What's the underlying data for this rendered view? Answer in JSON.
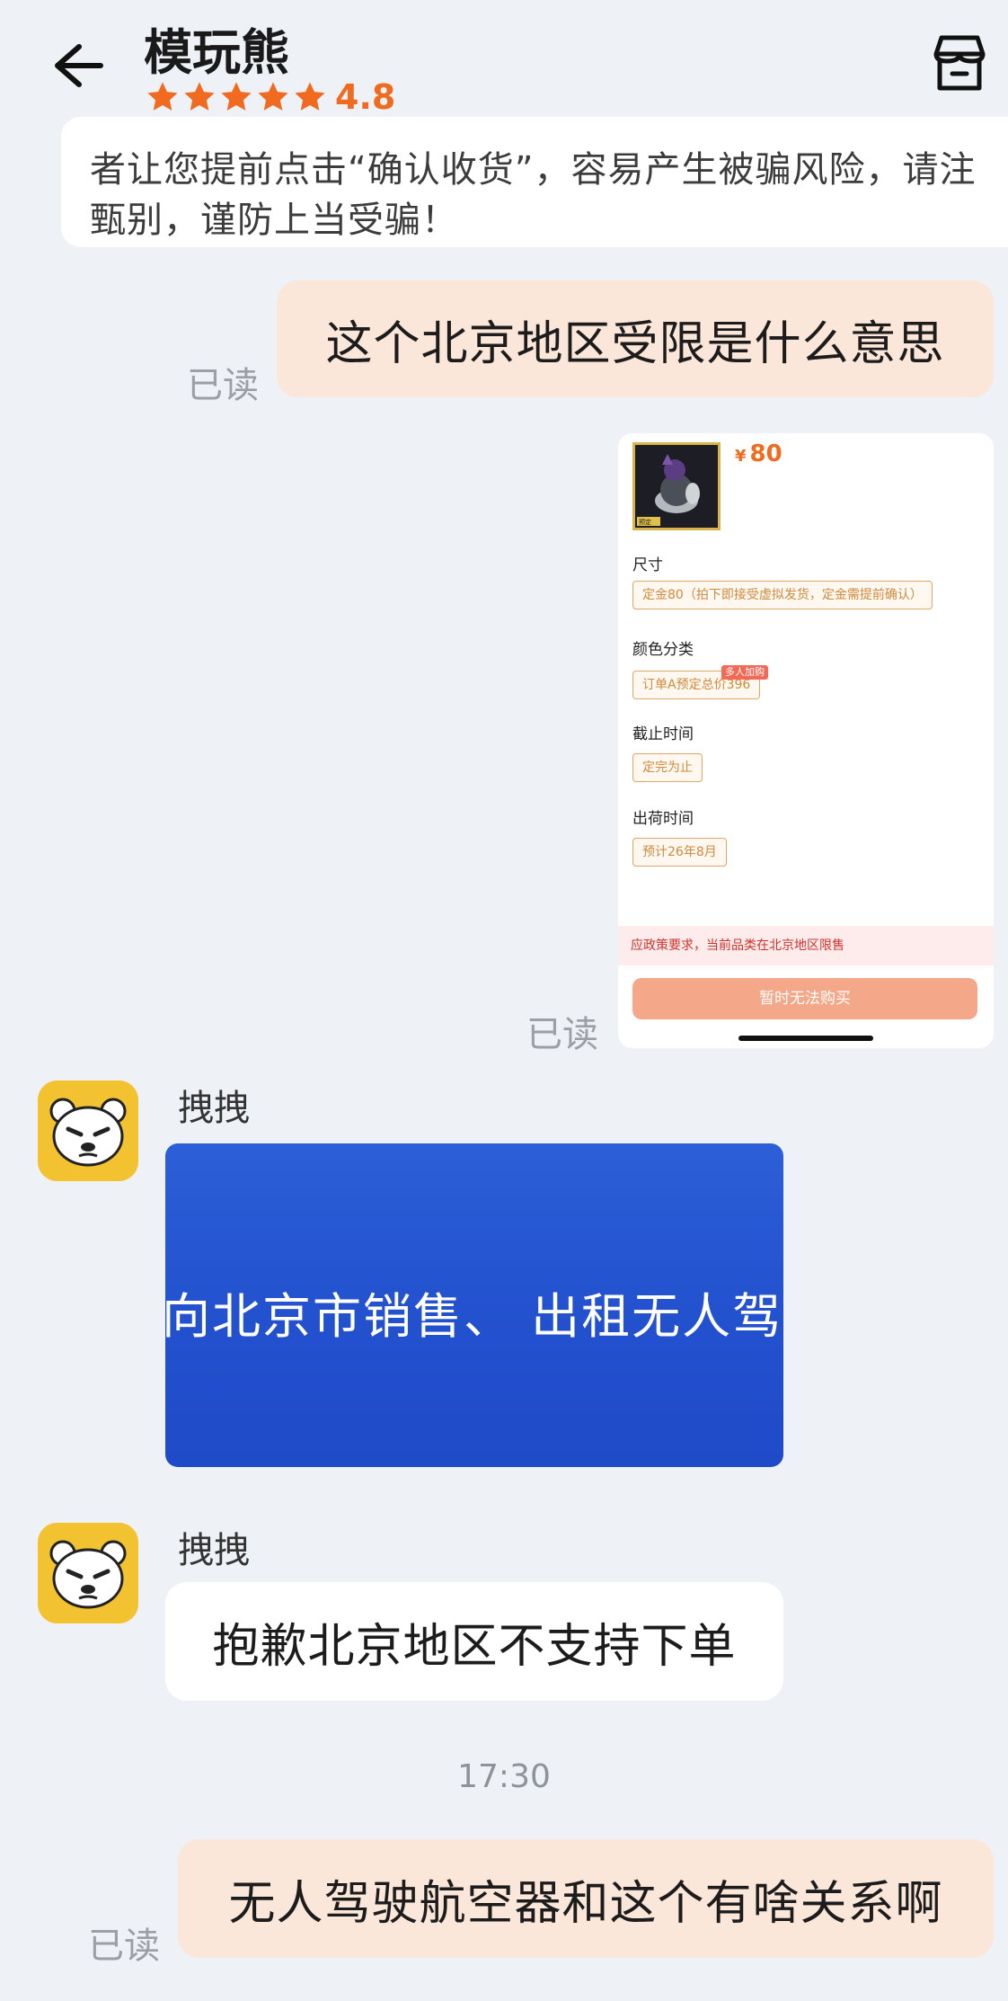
{
  "header": {
    "shop_name": "模玩熊",
    "rating": "4.8",
    "stars": 5
  },
  "notice": {
    "line1": "者让您提前点击“确认收货”，容易产生被骗风险，请注",
    "line2": "甄别，谨防上当受骗！"
  },
  "messages": {
    "m1": {
      "text": "这个北京地区受限是什么意思",
      "status": "已读"
    },
    "m2": {
      "status": "已读",
      "product": {
        "price_symbol": "¥",
        "price": "80",
        "thumb_label": "预定",
        "specs": [
          {
            "label": "尺寸",
            "value": "定金80（拍下即接受虚拟发货，定金需提前确认）"
          },
          {
            "label": "颜色分类",
            "value": "订单A预定总价396",
            "badge": "多人加购"
          },
          {
            "label": "截止时间",
            "value": "定完为止"
          },
          {
            "label": "出荷时间",
            "value": "预计26年8月"
          }
        ],
        "restriction": "应政策要求，当前品类在北京地区限售",
        "buy_label": "暂时无法购买"
      }
    },
    "m3": {
      "sender": "拽拽",
      "image_text": "向北京市销售、 出租无人驾驶"
    },
    "m4": {
      "sender": "拽拽",
      "text": "抱歉北京地区不支持下单"
    },
    "timestamp": "17:30",
    "m5": {
      "text": "无人驾驶航空器和这个有啥关系啊",
      "status": "已读"
    }
  },
  "colors": {
    "accent": "#f06a1f",
    "outgoing_bubble": "#fbe6da",
    "avatar_bg": "#f2c230"
  }
}
